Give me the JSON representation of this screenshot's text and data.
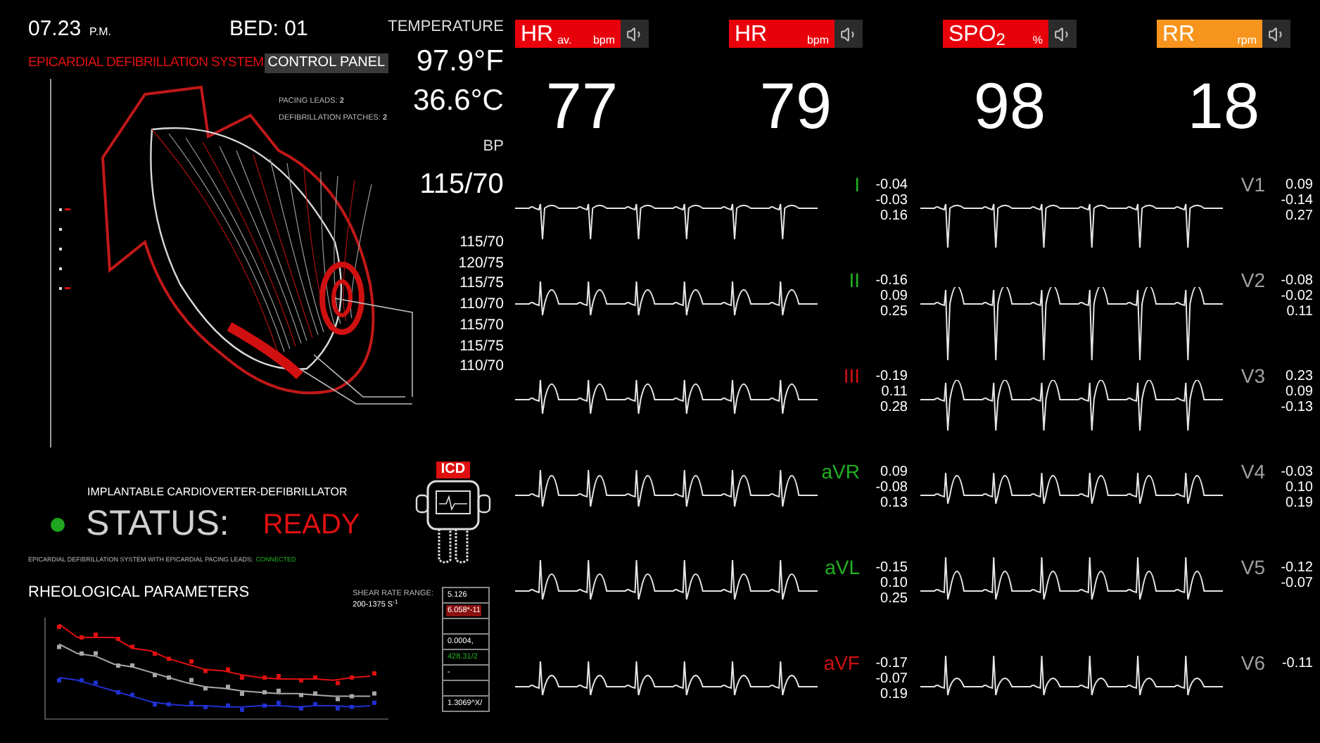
{
  "header": {
    "time": "07.23",
    "meridiem": "P.M.",
    "bed": "BED: 01"
  },
  "system": {
    "title": "EPICARDIAL DEFIBRILLATION SYSTEM",
    "control_panel": "CONTROL PANEL",
    "pacing_leads": "PACING LEADS: **2**",
    "defibrillation_patches": "DEFIBRILLATION PATCHES: **2**"
  },
  "temperature": {
    "label": "TEMPERATURE",
    "fahrenheit": "97.9°F",
    "celsius": "36.6°C"
  },
  "bp": {
    "label": "BP",
    "current": "115/70",
    "history": [
      "115/70",
      "120/75",
      "115/75",
      "110/70",
      "115/70",
      "115/75",
      "110/70"
    ]
  },
  "icd": {
    "badge": "ICD",
    "name": "IMPLANTABLE CARDIOVERTER-DEFIBRILLATOR",
    "status_dot": {
      "color": "#1fa51f"
    },
    "status_label": "STATUS:",
    "status": "READY",
    "connection_text": "EPICARDIAL DEFIBRILLATION SYSTEM WITH EPICARDIAL PACING LEADS:",
    "connection_state": "CONNECTED"
  },
  "rheology": {
    "title": "RHEOLOGICAL PARAMETERS",
    "shear_label": "SHEAR RATE RANGE:",
    "shear_range": "200-1375 S$^{-1}$",
    "values": [
      {
        "kind": "plain",
        "text": "5.126"
      },
      {
        "kind": "alert",
        "text": "6.058*-11"
      },
      {
        "kind": "empty"
      },
      {
        "kind": "plain",
        "text": "0.0004,"
      },
      {
        "kind": "ok",
        "text": "428.31/2"
      },
      {
        "kind": "plain",
        "text": "-"
      },
      {
        "kind": "empty"
      },
      {
        "kind": "plain",
        "text": "1.3069^X/"
      }
    ]
  },
  "vitals": [
    {
      "label": "HR",
      "sub": "av.",
      "unit": "bpm",
      "color": "#e8000b",
      "value": "77"
    },
    {
      "label": "HR",
      "unit": "bpm",
      "color": "#e8000b",
      "value": "79"
    },
    {
      "label": "SPO$_{2}$",
      "unit": "%",
      "color": "#e8000b",
      "value": "98"
    },
    {
      "label": "RR",
      "unit": "rpm",
      "color": "#f7941d",
      "value": "18"
    }
  ],
  "leads": {
    "left": [
      {
        "name": "I",
        "color": "#22b022",
        "values": [
          "-0.04",
          "-0.03",
          "0.16"
        ]
      },
      {
        "name": "II",
        "color": "#22b022",
        "values": [
          "-0.16",
          "0.09",
          "0.25"
        ]
      },
      {
        "name": "III",
        "color": "#d01010",
        "values": [
          "-0.19",
          "0.11",
          "0.28"
        ]
      },
      {
        "name": "aVR",
        "color": "#22b022",
        "values": [
          "0.09",
          "-0.08",
          "0.13"
        ]
      },
      {
        "name": "aVL",
        "color": "#22b022",
        "values": [
          "-0.15",
          "0.10",
          "0.25"
        ]
      },
      {
        "name": "aVF",
        "color": "#d01010",
        "values": [
          "-0.17",
          "-0.07",
          "0.19"
        ]
      }
    ],
    "right": [
      {
        "name": "V1",
        "color": "#a0a0a0",
        "values": [
          "0.09",
          "-0.14",
          "0.27"
        ]
      },
      {
        "name": "V2",
        "color": "#a0a0a0",
        "values": [
          "-0.08",
          "-0.02",
          "0.11"
        ]
      },
      {
        "name": "V3",
        "color": "#a0a0a0",
        "values": [
          "0.23",
          "0.09",
          "-0.13"
        ]
      },
      {
        "name": "V4",
        "color": "#a0a0a0",
        "values": [
          "-0.03",
          "0.10",
          "0.19"
        ]
      },
      {
        "name": "V5",
        "color": "#a0a0a0",
        "values": [
          "-0.12",
          "-0.07"
        ]
      },
      {
        "name": "V6",
        "color": "#a0a0a0",
        "values": [
          "-0.11"
        ]
      }
    ]
  }
}
